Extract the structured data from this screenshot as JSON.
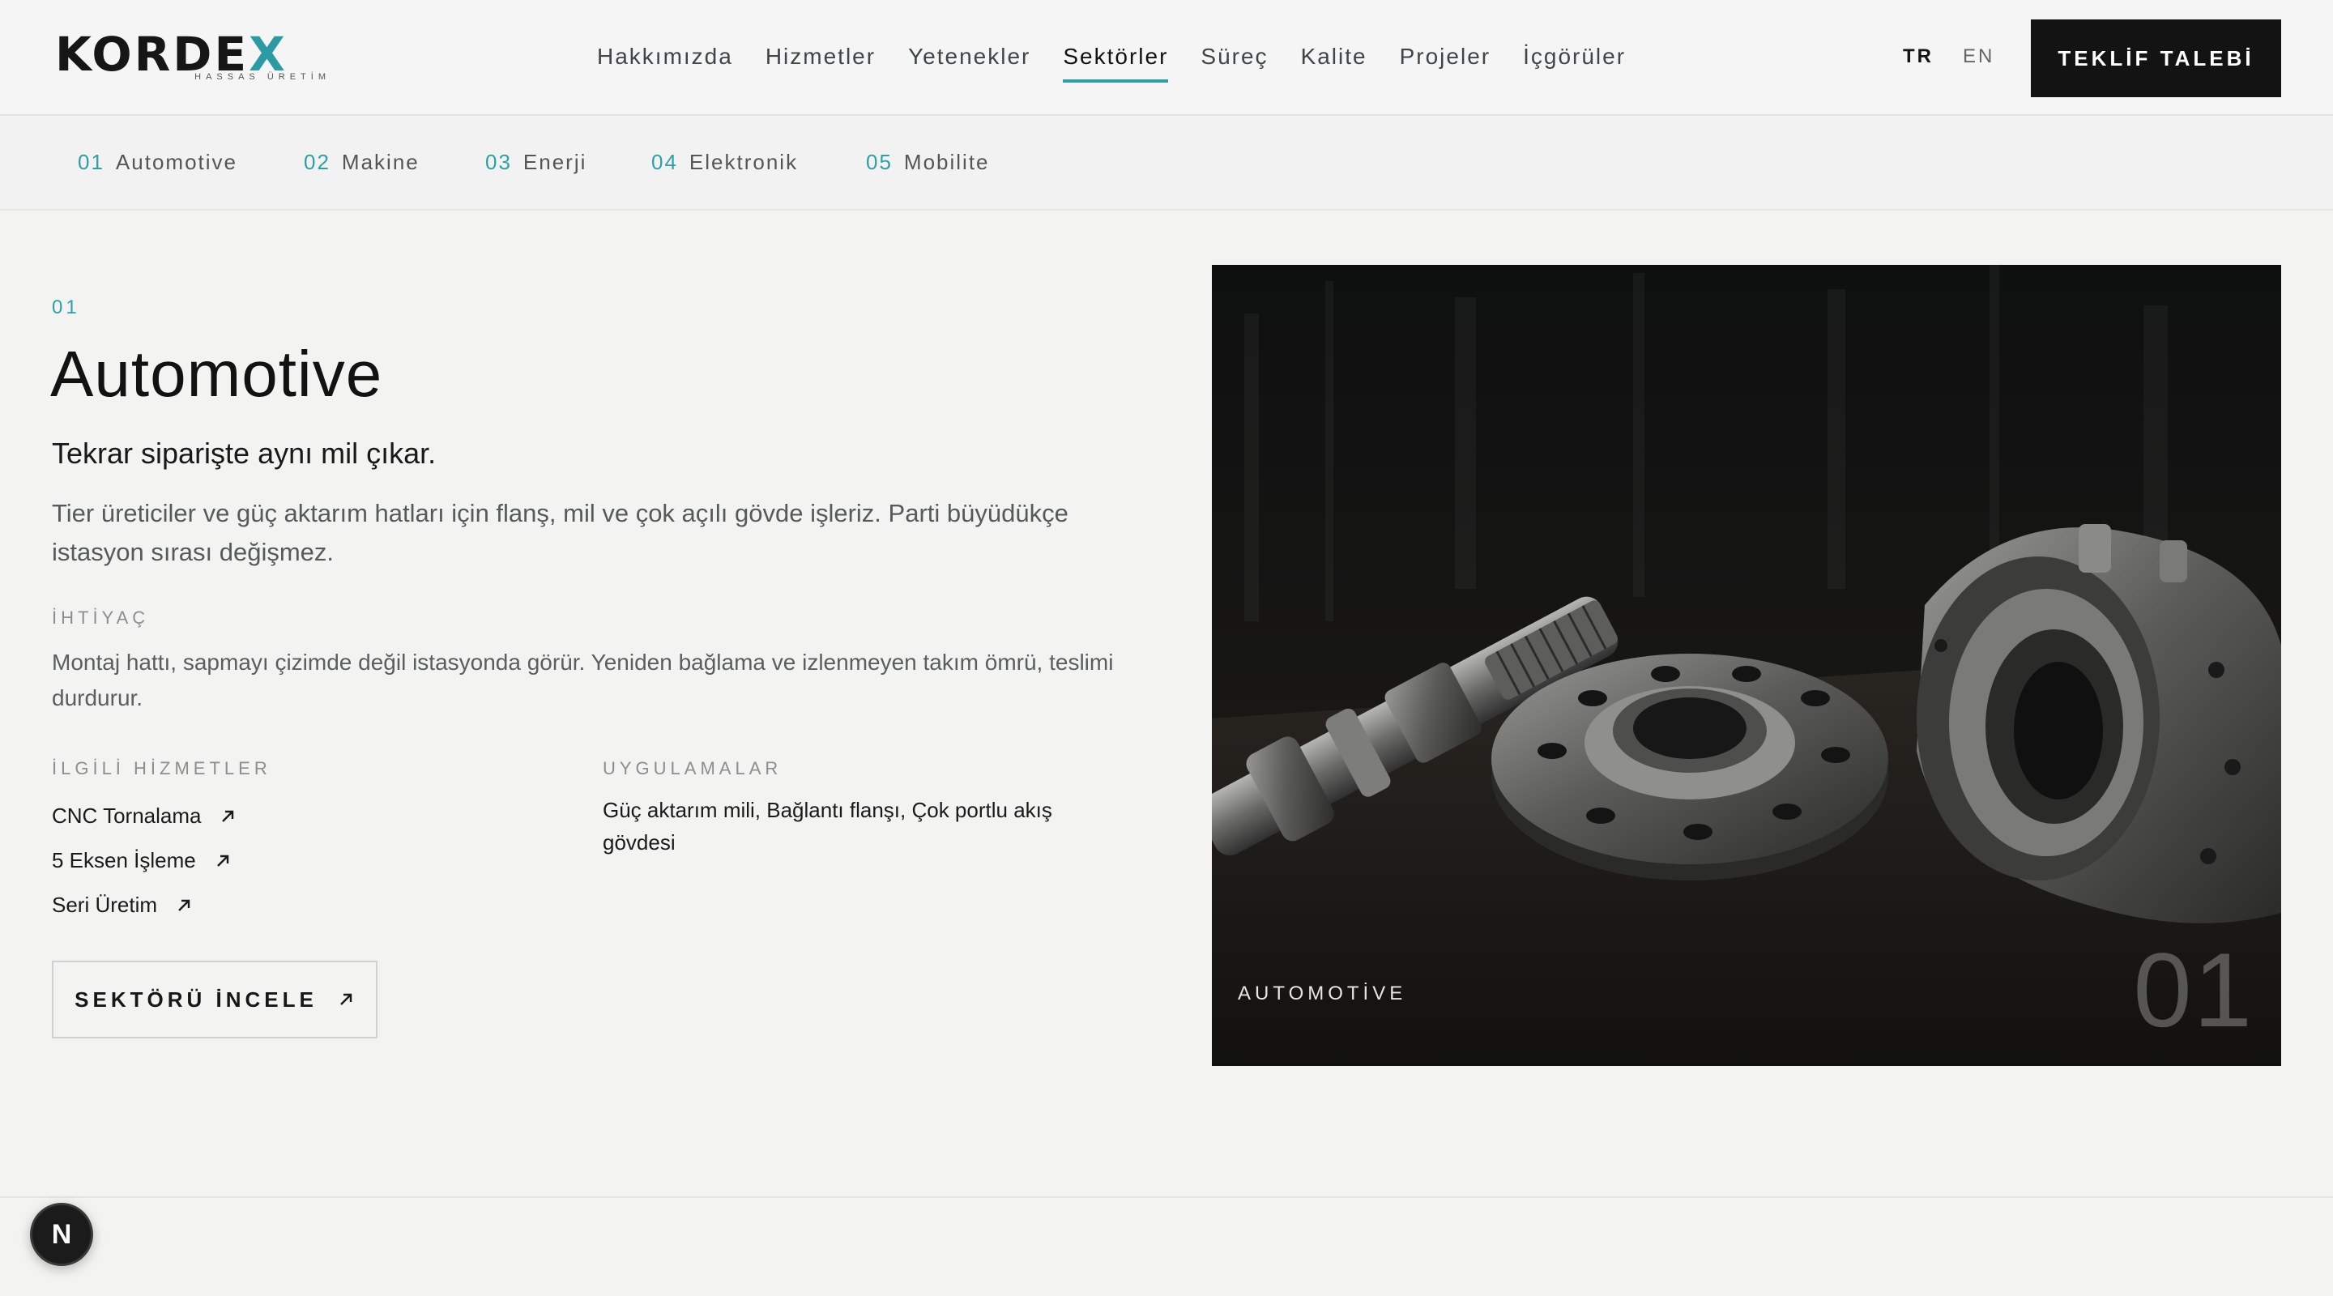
{
  "header": {
    "logo": {
      "word_main": "KORDE",
      "word_accent": "X",
      "tagline": "HASSAS ÜRETİM"
    },
    "nav": [
      {
        "label": "Hakkımızda"
      },
      {
        "label": "Hizmetler"
      },
      {
        "label": "Yetenekler"
      },
      {
        "label": "Sektörler",
        "active": true
      },
      {
        "label": "Süreç"
      },
      {
        "label": "Kalite"
      },
      {
        "label": "Projeler"
      },
      {
        "label": "İçgörüler"
      }
    ],
    "languages": {
      "tr": "TR",
      "en": "EN",
      "selected": "TR"
    },
    "cta_label": "TEKLİF TALEBİ"
  },
  "subnav": [
    {
      "num": "01",
      "label": "Automotive"
    },
    {
      "num": "02",
      "label": "Makine"
    },
    {
      "num": "03",
      "label": "Enerji"
    },
    {
      "num": "04",
      "label": "Elektronik"
    },
    {
      "num": "05",
      "label": "Mobilite"
    }
  ],
  "sector": {
    "number": "01",
    "title": "Automotive",
    "subtitle": "Tekrar siparişte aynı mil çıkar.",
    "lead": "Tier üreticiler ve güç aktarım hatları için flanş, mil ve çok açılı gövde işleriz. Parti büyüdükçe istasyon sırası değişmez.",
    "need_label": "İHTİYAÇ",
    "need_text": "Montaj hattı, sapmayı çizimde değil istasyonda görür. Yeniden bağlama ve izlenmeyen takım ömrü, teslimi durdurur.",
    "related_label": "İLGİLİ HİZMETLER",
    "related": [
      {
        "label": "CNC Tornalama"
      },
      {
        "label": "5 Eksen İşleme"
      },
      {
        "label": "Seri Üretim"
      }
    ],
    "apps_label": "UYGULAMALAR",
    "apps_text": "Güç aktarım mili, Bağlantı flanşı, Çok portlu akış gövdesi",
    "explore_label": "SEKTÖRÜ İNCELE",
    "image_caption": "AUTOMOTİVE",
    "image_number": "01"
  },
  "dev_badge": "N",
  "colors": {
    "accent": "#2fa0a6",
    "dark": "#131313",
    "background": "#f3f3f1"
  }
}
